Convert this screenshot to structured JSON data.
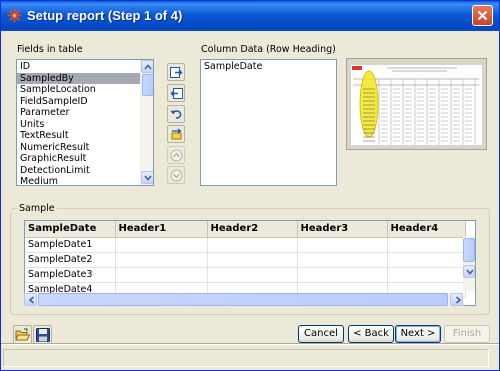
{
  "window": {
    "title": "Setup report (Step 1 of 4)"
  },
  "fields": {
    "label": "Fields in table",
    "items": [
      "ID",
      "SampledBy",
      "SampleLocation",
      "FieldSampleID",
      "Parameter",
      "Units",
      "TextResult",
      "NumericResult",
      "GraphicResult",
      "DetectionLimit",
      "Medium"
    ],
    "selected": "SampledBy"
  },
  "column_data": {
    "label": "Column Data (Row Heading)",
    "items": [
      "SampleDate"
    ]
  },
  "sample": {
    "label": "Sample",
    "columns": [
      "SampleDate",
      "Header1",
      "Header2",
      "Header3",
      "Header4"
    ],
    "rows": [
      "SampleDate1",
      "SampleDate2",
      "SampleDate3",
      "SampleDate4"
    ]
  },
  "buttons": {
    "cancel": "Cancel",
    "back": "< Back",
    "next": "Next >",
    "finish": "Finish"
  },
  "icons": {
    "title": "app-icon",
    "move_right": "move-right-icon",
    "move_left": "move-left-icon",
    "undo": "undo-icon",
    "swap": "swap-icon",
    "up": "move-up-icon",
    "down": "move-down-icon",
    "open": "open-folder-icon",
    "save": "save-disk-icon"
  },
  "colors": {
    "title_bar": "#0a5fd8",
    "selection": "#a5a9b3",
    "highlight_ellipse": "#f5e61a"
  }
}
